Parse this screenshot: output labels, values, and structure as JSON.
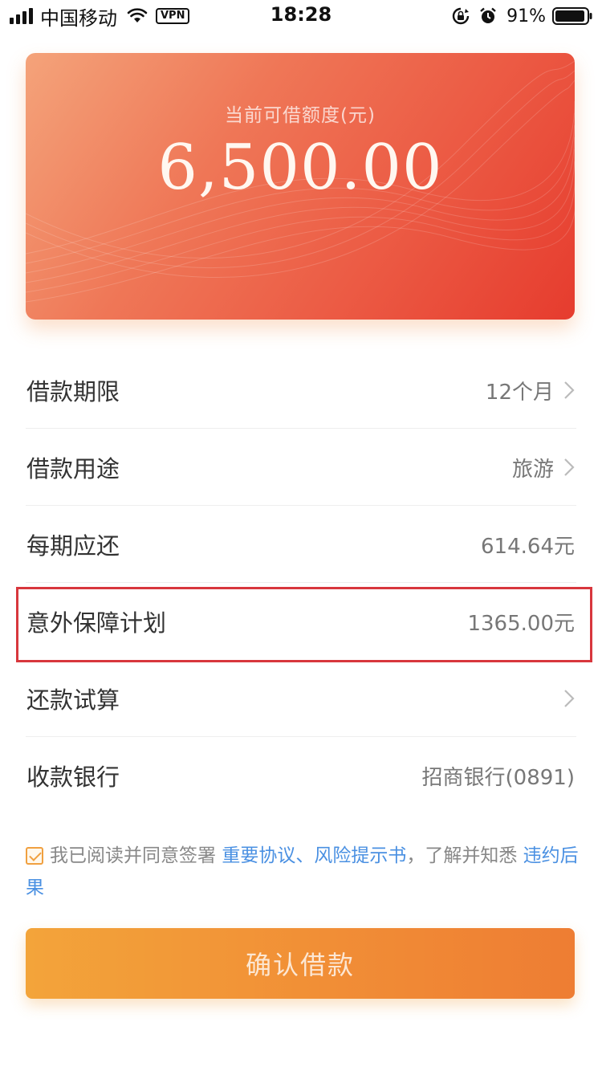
{
  "status_bar": {
    "carrier": "中国移动",
    "vpn": "VPN",
    "time": "18:28",
    "battery": "91%"
  },
  "card": {
    "label": "当前可借额度(元)",
    "amount": "6,500.00"
  },
  "rows": [
    {
      "label": "借款期限",
      "value": "12个月"
    },
    {
      "label": "借款用途",
      "value": "旅游"
    },
    {
      "label": "每期应还",
      "value": "614.64元"
    },
    {
      "label": "意外保障计划",
      "value": "1365.00元"
    },
    {
      "label": "还款试算",
      "value": ""
    },
    {
      "label": "收款银行",
      "value": "招商银行(0891)"
    }
  ],
  "agreement": {
    "prefix": "我已阅读并同意签署",
    "link1": "重要协议、风险提示书",
    "middle": "，了解并知悉",
    "link2": "违约后果"
  },
  "confirm_button": {
    "label": "确认借款"
  },
  "colors": {
    "card_start": "#f4a37a",
    "card_end": "#e63c2e",
    "button": "#f18e36",
    "link": "#4a90e2",
    "highlight": "#d8373d"
  }
}
